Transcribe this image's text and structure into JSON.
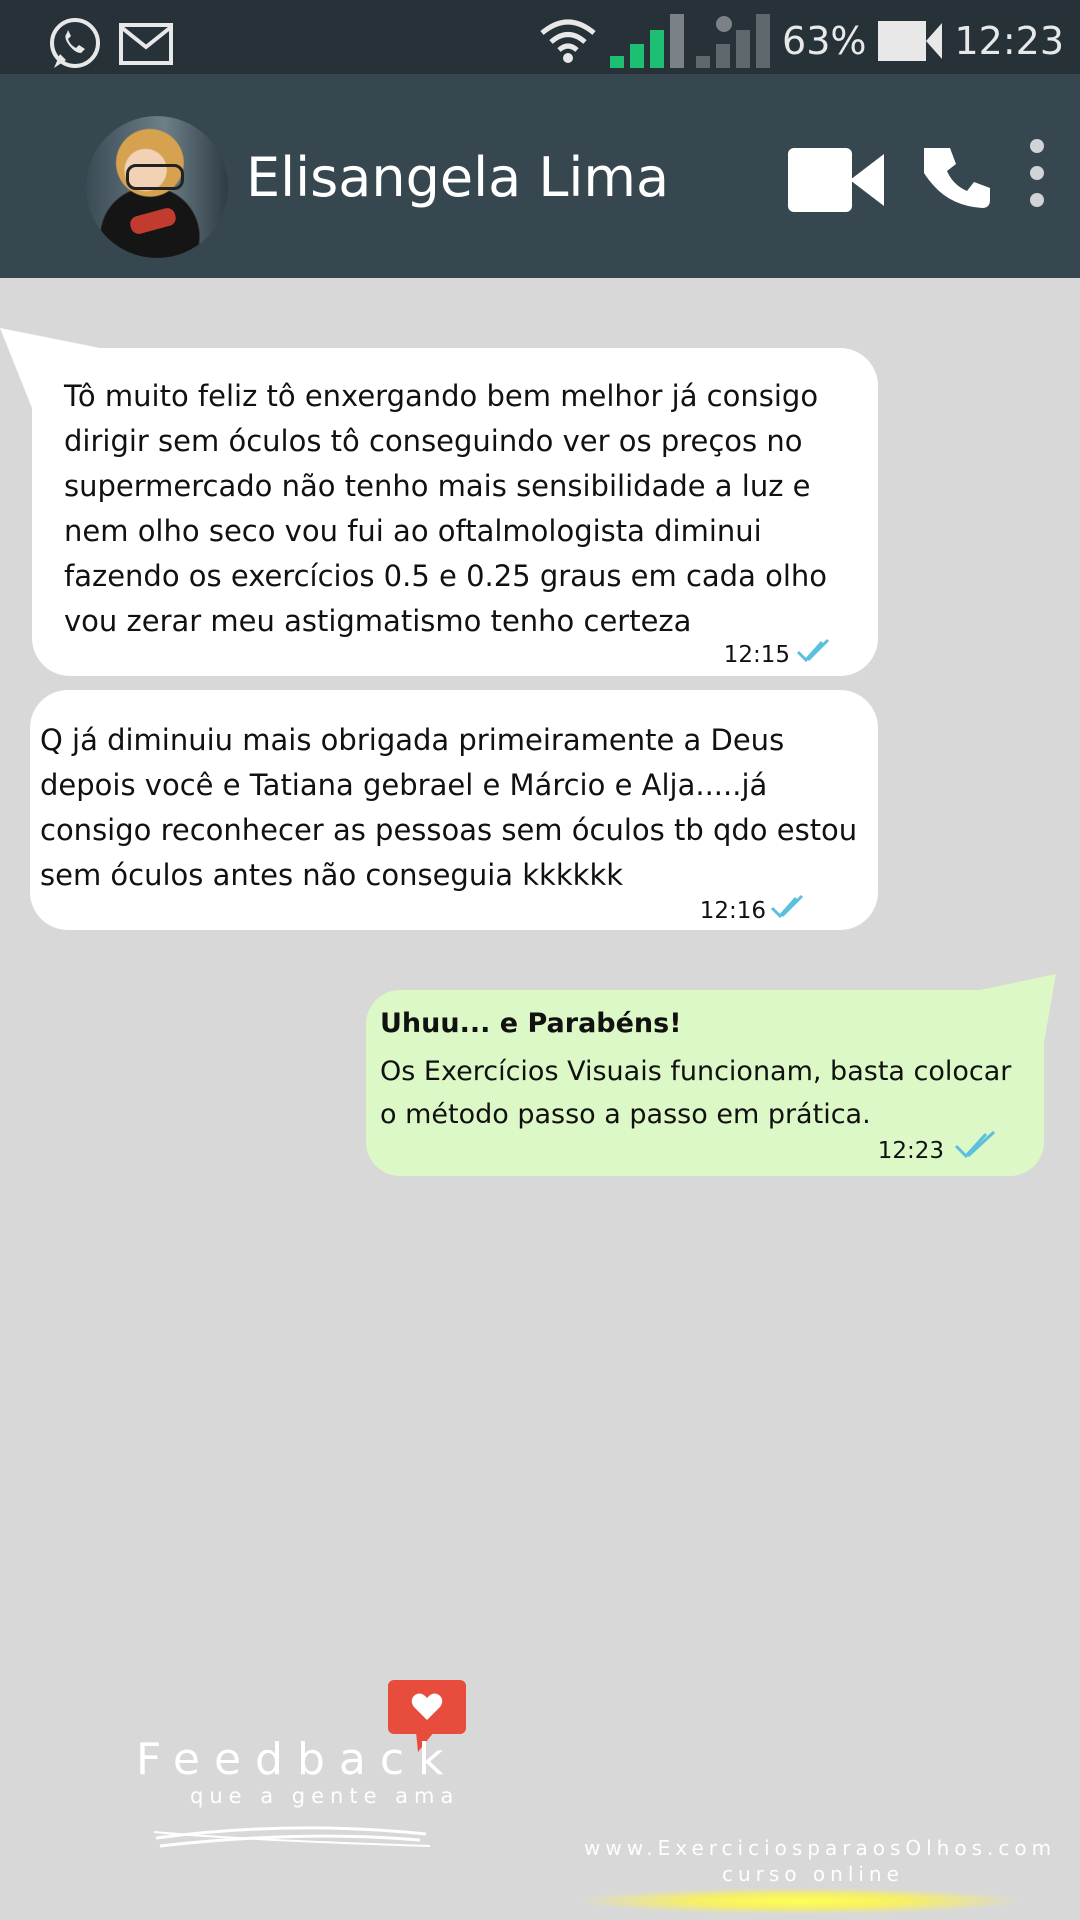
{
  "status_bar": {
    "battery_percent": "63%",
    "time": "12:23",
    "icons": [
      "whatsapp-icon",
      "email-icon",
      "wifi-icon",
      "signal-icon",
      "signal-icon-2",
      "battery-icon"
    ]
  },
  "header": {
    "contact_name": "Elisangela Lima",
    "icons": [
      "video-call-icon",
      "phone-call-icon",
      "more-options-icon"
    ]
  },
  "messages": [
    {
      "direction": "incoming",
      "text": "Tô muito feliz tô enxergando bem melhor já consigo\ndirigir sem óculos tô conseguindo ver os preços no\nsupermercado não tenho mais sensibilidade a luz e\nnem olho seco vou fui ao oftalmologista diminui\nfazendo os exercícios 0.5 e 0.25 graus em cada olho\nvou zerar meu astigmatismo tenho certeza",
      "time": "12:15"
    },
    {
      "direction": "incoming",
      "text": "Q já diminuiu mais obrigada primeiramente a Deus\ndepois você e Tatiana gebrael e Márcio e Alja.....já\nconsigo reconhecer as pessoas sem óculos tb qdo estou\nsem óculos antes não conseguia kkkkkk",
      "time": "12:16"
    },
    {
      "direction": "outgoing",
      "title": "Uhuu... e Parabéns!",
      "text": "Os Exercícios Visuais funcionam, basta colocar\no método passo a passo em prática.",
      "time": "12:23"
    }
  ],
  "branding": {
    "word": "Feedback",
    "subtitle": "que a gente ama",
    "website": "www.ExerciciosparaosOlhos.com",
    "website_sub": "curso online",
    "accent_color": "#e74c3c"
  },
  "colors": {
    "status_bar": "#263238",
    "header": "#37474f",
    "background": "#d8d8d8",
    "incoming_bubble": "#ffffff",
    "outgoing_bubble": "#dcf8c6",
    "signal_active": "#1dbf73",
    "read_ticks": "#5bc0de"
  }
}
